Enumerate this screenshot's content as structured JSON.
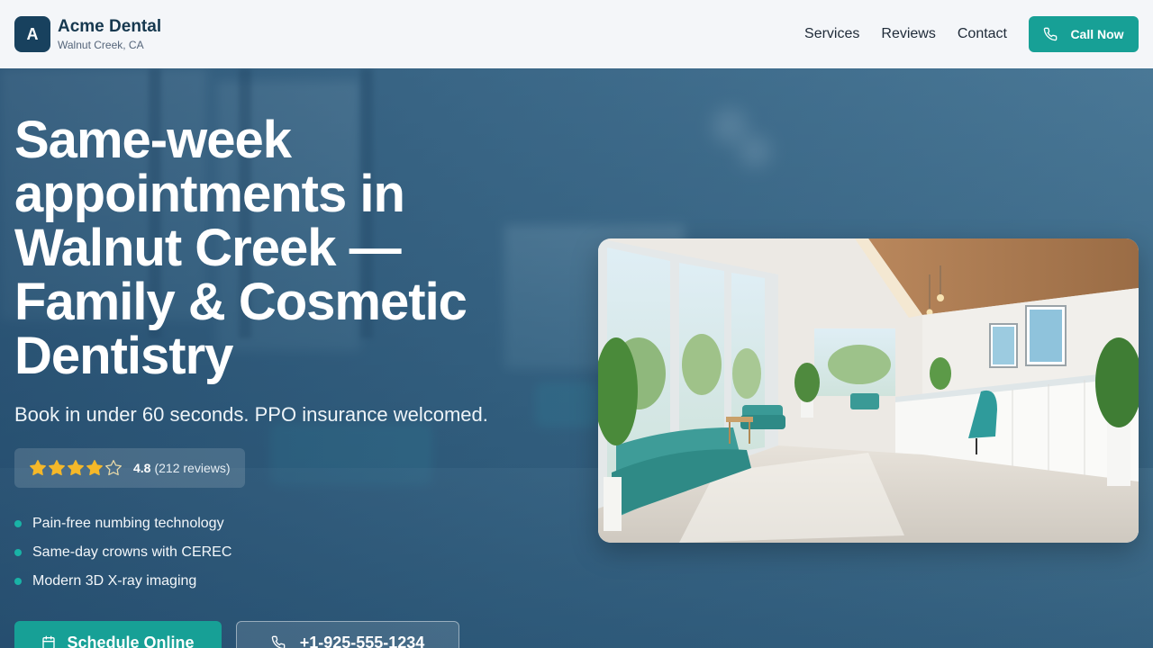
{
  "brand": {
    "logo_letter": "A",
    "name": "Acme Dental",
    "location": "Walnut Creek, CA"
  },
  "nav": {
    "links": [
      "Services",
      "Reviews",
      "Contact"
    ],
    "call_label": "Call Now",
    "call_icon": "phone-icon"
  },
  "hero": {
    "headline": "Same-week appointments in Walnut Creek — Family & Cosmetic Dentistry",
    "subheadline": "Book in under 60 seconds. PPO insurance welcomed.",
    "rating": {
      "stars_filled": 4,
      "stars_total": 5,
      "value": "4.8",
      "count_text": "(212 reviews)"
    },
    "features": [
      "Pain-free numbing technology",
      "Same-day crowns with CEREC",
      "Modern 3D X-ray imaging"
    ],
    "cta_primary": {
      "label": "Schedule Online",
      "icon": "calendar-icon"
    },
    "cta_secondary": {
      "label": "+1-925-555-1234",
      "icon": "phone-icon"
    },
    "image": {
      "subject": "clinic-waiting-room-photo"
    }
  },
  "colors": {
    "accent": "#17a096",
    "brand_dark": "#18415e",
    "star": "#f5b829",
    "hero_overlay": "#2a5a80",
    "nav_bg": "#f4f6f9"
  }
}
